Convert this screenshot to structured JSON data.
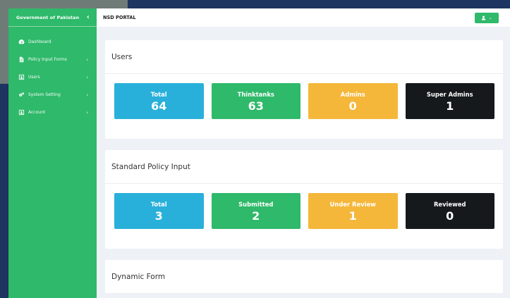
{
  "colors": {
    "frame": "#1e3461",
    "sidebar": "#2fb96a",
    "blue": "#29b0da",
    "green": "#2fb96a",
    "yellow": "#f5b73a",
    "black": "#15191c"
  },
  "sidebar": {
    "title": "Government of Pakistan",
    "collapse_icon": "‹",
    "items": [
      {
        "label": "Dashboard",
        "icon": "dashboard-icon",
        "chevron": ""
      },
      {
        "label": "Policy Input Forms",
        "icon": "file-icon",
        "chevron": "›"
      },
      {
        "label": "Users",
        "icon": "users-icon",
        "chevron": "›"
      },
      {
        "label": "System Setting",
        "icon": "gears-icon",
        "chevron": "›"
      },
      {
        "label": "Account",
        "icon": "account-icon",
        "chevron": "›"
      }
    ]
  },
  "topbar": {
    "title": "NSD PORTAL",
    "user_caret": "⌄"
  },
  "sections": [
    {
      "title": "Users",
      "stats": [
        {
          "label": "Total",
          "value": "64"
        },
        {
          "label": "Thinktanks",
          "value": "63"
        },
        {
          "label": "Admins",
          "value": "0"
        },
        {
          "label": "Super Admins",
          "value": "1"
        }
      ]
    },
    {
      "title": "Standard Policy Input",
      "stats": [
        {
          "label": "Total",
          "value": "3"
        },
        {
          "label": "Submitted",
          "value": "2"
        },
        {
          "label": "Under Review",
          "value": "1"
        },
        {
          "label": "Reviewed",
          "value": "0"
        }
      ]
    },
    {
      "title": "Dynamic Form"
    }
  ]
}
